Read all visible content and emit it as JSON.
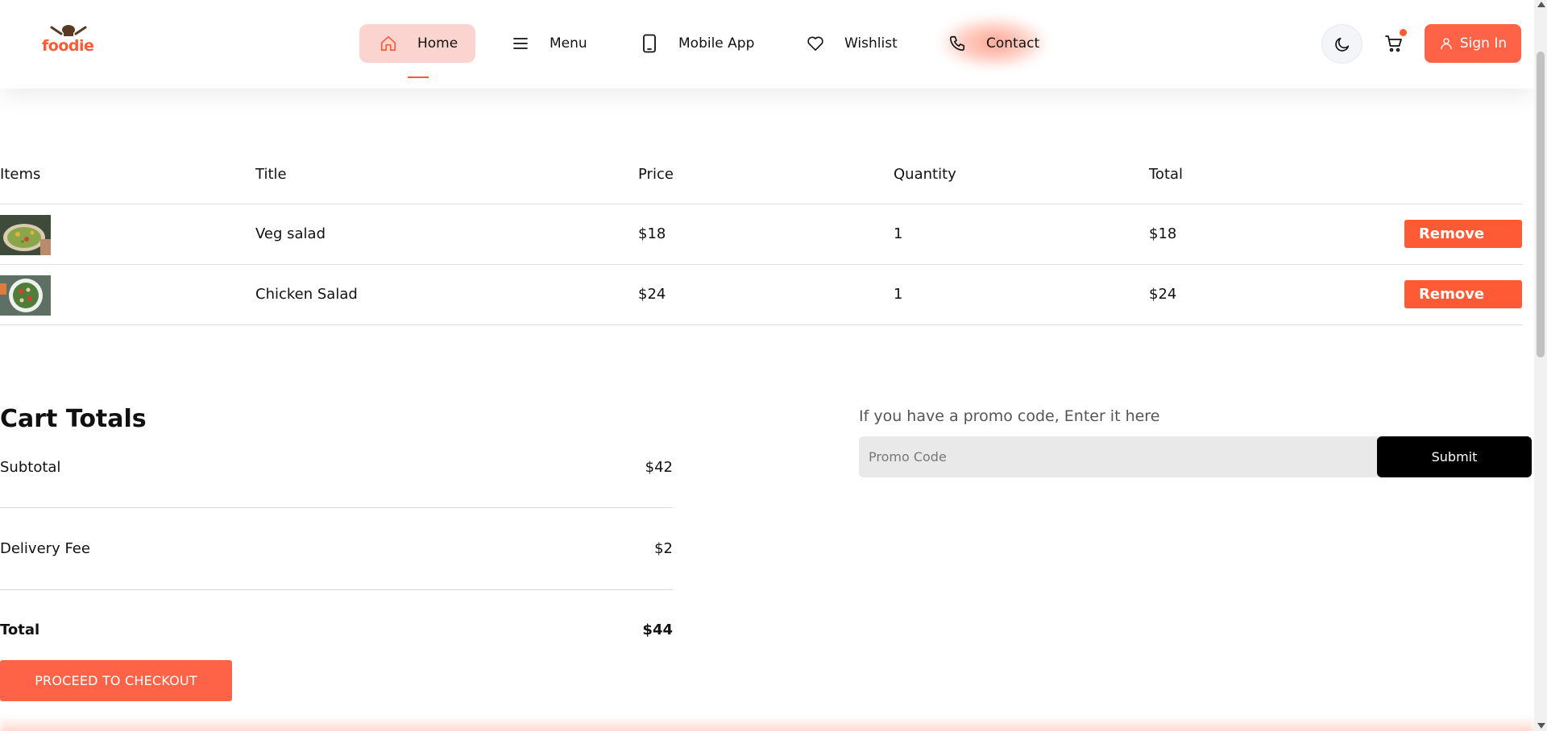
{
  "header": {
    "logo_text": "foodie",
    "nav": [
      {
        "label": "Home",
        "icon": "home-icon",
        "active": true
      },
      {
        "label": "Menu",
        "icon": "menu-icon"
      },
      {
        "label": "Mobile App",
        "icon": "mobile-icon"
      },
      {
        "label": "Wishlist",
        "icon": "heart-icon"
      },
      {
        "label": "Contact",
        "icon": "phone-icon"
      }
    ],
    "theme_icon": "moon-icon",
    "cart_icon": "cart-icon",
    "signin_label": "Sign In",
    "signin_icon": "user-icon",
    "accent_color": "#ff5a36"
  },
  "cart_table": {
    "headers": [
      "Items",
      "Title",
      "Price",
      "Quantity",
      "Total"
    ],
    "rows": [
      {
        "title": "Veg salad",
        "price": "$18",
        "quantity": "1",
        "total": "$18",
        "remove_label": "Remove"
      },
      {
        "title": "Chicken Salad",
        "price": "$24",
        "quantity": "1",
        "total": "$24",
        "remove_label": "Remove"
      }
    ]
  },
  "cart_totals": {
    "title": "Cart Totals",
    "subtotal_label": "Subtotal",
    "subtotal_value": "$42",
    "delivery_label": "Delivery Fee",
    "delivery_value": "$2",
    "total_label": "Total",
    "total_value": "$44",
    "checkout_label": "PROCEED TO CHECKOUT"
  },
  "promo": {
    "label": "If you have a promo code, Enter it here",
    "placeholder": "Promo Code",
    "submit_label": "Submit"
  }
}
